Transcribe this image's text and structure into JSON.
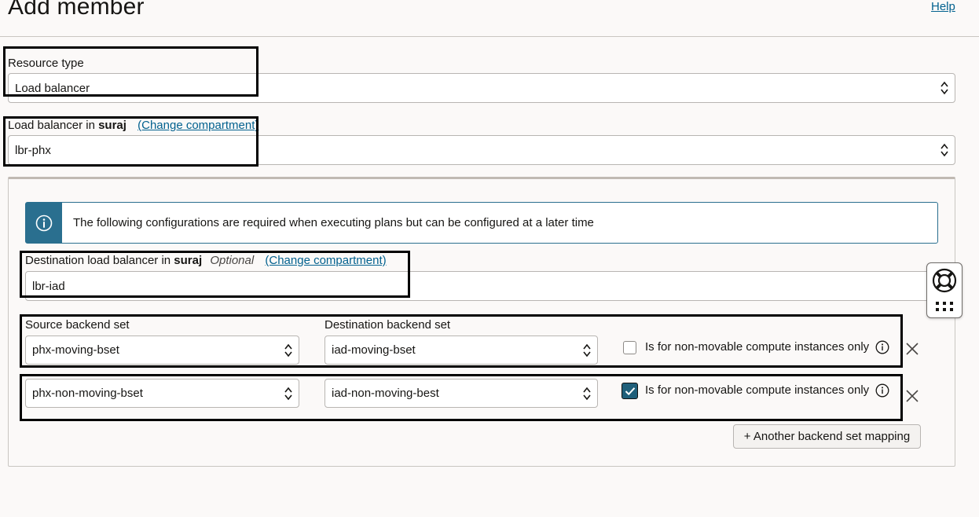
{
  "page": {
    "title": "Add member",
    "help_label": "Help"
  },
  "resource_type": {
    "label": "Resource type",
    "value": "Load balancer"
  },
  "load_balancer": {
    "label_prefix": "Load balancer in",
    "compartment": "suraj",
    "change_link": "(Change compartment)",
    "value": "lbr-phx"
  },
  "info_banner": {
    "icon": "info-icon",
    "text": "The following configurations are required when executing plans but can be configured at a later time"
  },
  "destination_lb": {
    "label_prefix": "Destination load balancer in",
    "compartment": "suraj",
    "optional_label": "Optional",
    "change_link": "(Change compartment)",
    "value": "lbr-iad"
  },
  "backend_mappings": {
    "source_header": "Source backend set",
    "destination_header": "Destination backend set",
    "rows": [
      {
        "source": "phx-moving-bset",
        "destination": "iad-moving-bset",
        "non_movable_label": "Is for non-movable compute instances only",
        "non_movable_checked": false
      },
      {
        "source": "phx-non-moving-bset",
        "destination": "iad-non-moving-best",
        "non_movable_label": "Is for non-movable compute instances only",
        "non_movable_checked": true
      }
    ],
    "add_button": "+ Another backend set mapping"
  },
  "colors": {
    "link": "#02618f",
    "info_accent": "#2a6f8f",
    "checkbox_checked": "#1f5f7a"
  }
}
